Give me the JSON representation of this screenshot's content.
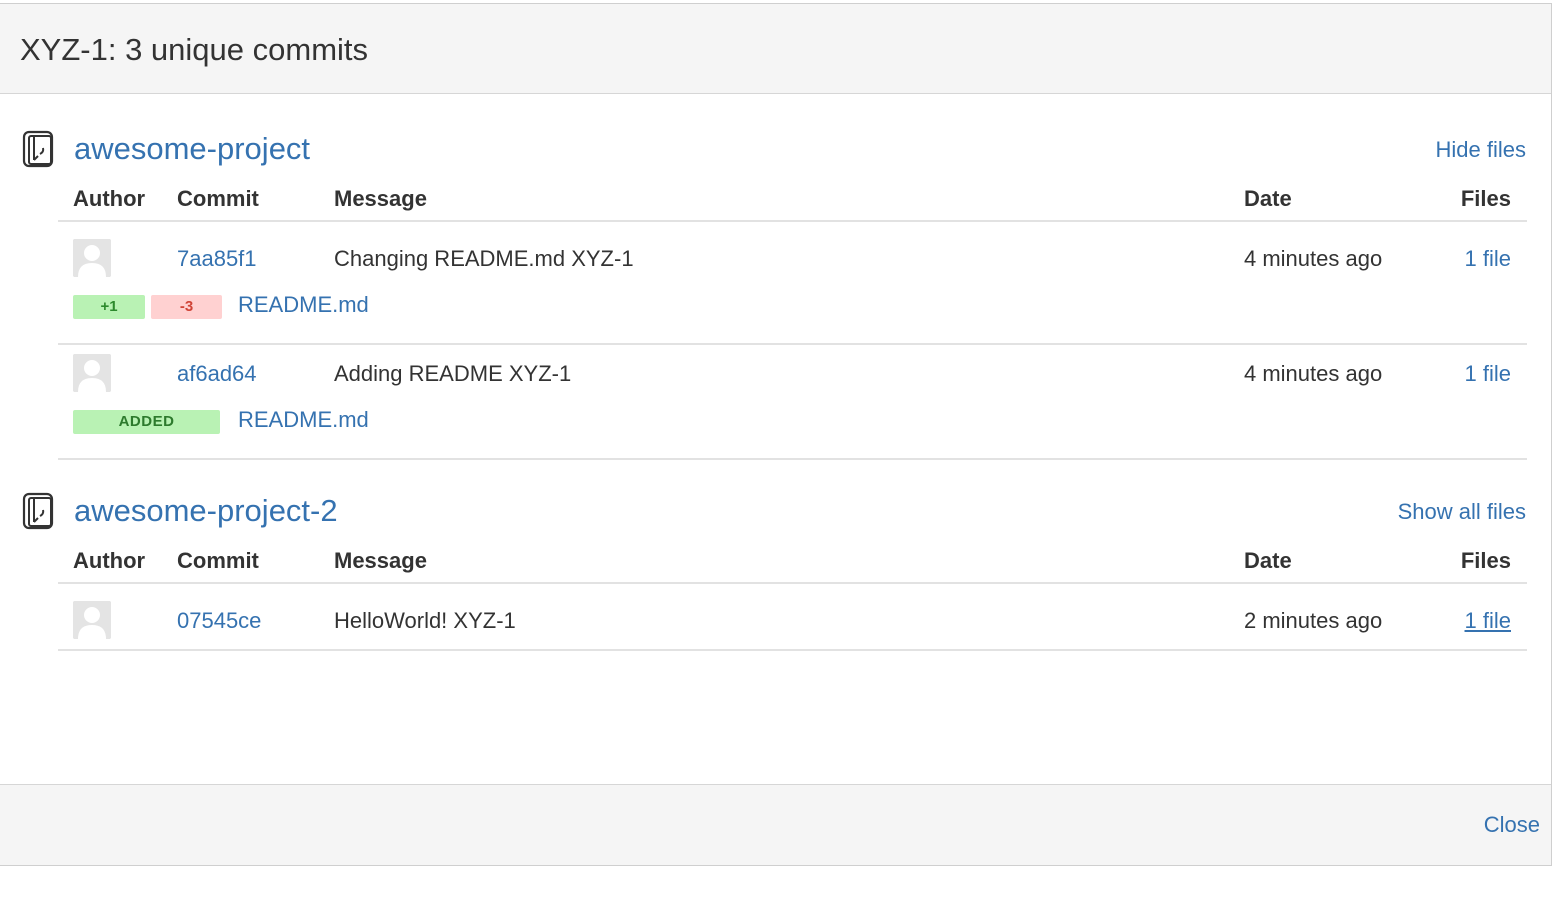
{
  "dialog": {
    "title": "XYZ-1: 3 unique commits",
    "close_label": "Close"
  },
  "columns": {
    "author": "Author",
    "commit": "Commit",
    "message": "Message",
    "date": "Date",
    "files": "Files"
  },
  "repos": [
    {
      "name": "awesome-project",
      "toggle_label": "Hide files",
      "commits": [
        {
          "hash": "7aa85f1",
          "message": "Changing README.md XYZ-1",
          "date": "4 minutes ago",
          "files_label": "1 file",
          "file": {
            "name": "README.md",
            "additions": "+1",
            "deletions": "-3"
          }
        },
        {
          "hash": "af6ad64",
          "message": "Adding README XYZ-1",
          "date": "4 minutes ago",
          "files_label": "1 file",
          "file": {
            "name": "README.md",
            "status": "ADDED"
          }
        }
      ]
    },
    {
      "name": "awesome-project-2",
      "toggle_label": "Show all files",
      "commits": [
        {
          "hash": "07545ce",
          "message": "HelloWorld! XYZ-1",
          "date": "2 minutes ago",
          "files_label": "1 file"
        }
      ]
    }
  ],
  "colors": {
    "link": "#3572b0",
    "added_bg": "#b9f2b4",
    "removed_bg": "#ffd1d1",
    "header_bg": "#f5f5f5"
  },
  "icons": {
    "repo": "repository-icon",
    "avatar": "default-avatar-icon"
  }
}
